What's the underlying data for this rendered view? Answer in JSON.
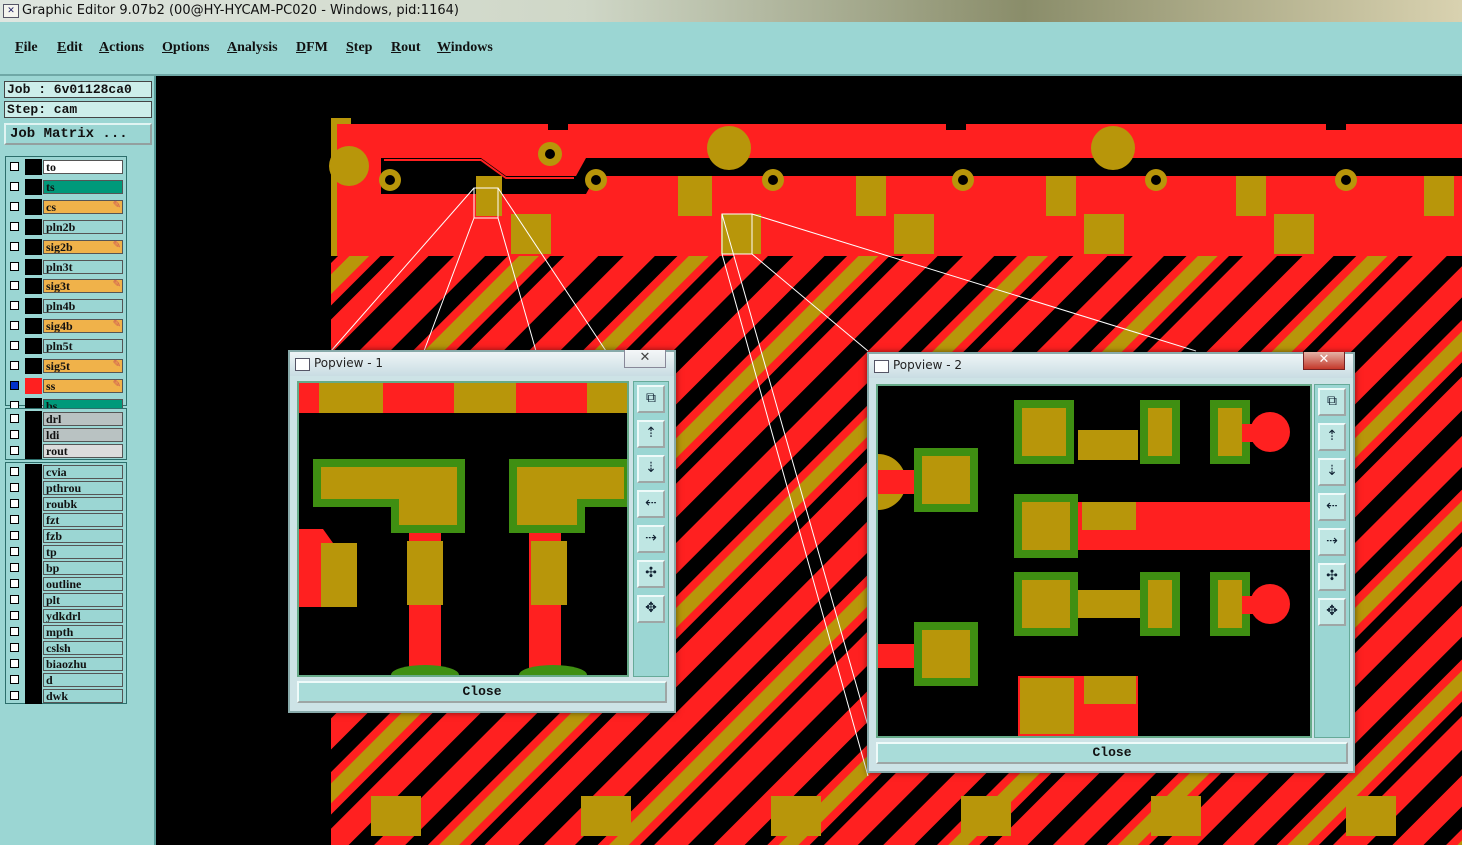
{
  "title_bar": {
    "title": "Graphic Editor 9.07b2 (00@HY-HYCAM-PC020 - Windows, pid:1164)",
    "icon": "app-x-icon"
  },
  "menu": [
    "File",
    "Edit",
    "Actions",
    "Options",
    "Analysis",
    "DFM",
    "Step",
    "Rout",
    "Windows"
  ],
  "info": {
    "job": "Job : 6v01128ca0",
    "step": "Step: cam",
    "job_matrix": "Job Matrix ..."
  },
  "layers_group1": [
    {
      "name": "to",
      "color": "#ffffff"
    },
    {
      "name": "ts",
      "color": "#00997a"
    },
    {
      "name": "cs",
      "color": "#f0b24a",
      "editable": true
    },
    {
      "name": "pln2b",
      "color": "#9bd6d3"
    },
    {
      "name": "sig2b",
      "color": "#f0b24a",
      "editable": true
    },
    {
      "name": "pln3t",
      "color": "#9bd6d3"
    },
    {
      "name": "sig3t",
      "color": "#f0b24a",
      "editable": true
    },
    {
      "name": "pln4b",
      "color": "#9bd6d3"
    },
    {
      "name": "sig4b",
      "color": "#f0b24a",
      "editable": true
    },
    {
      "name": "pln5t",
      "color": "#9bd6d3"
    },
    {
      "name": "sig5t",
      "color": "#f0b24a",
      "editable": true
    },
    {
      "name": "ss",
      "color": "#f0b24a",
      "editable": true,
      "active": true
    },
    {
      "name": "bs",
      "color": "#00997a"
    }
  ],
  "layers_group2": [
    {
      "name": "drl",
      "color": "#b9c2c2"
    },
    {
      "name": "ldi",
      "color": "#b9c2c2"
    },
    {
      "name": "rout",
      "color": "#dcdcdc"
    }
  ],
  "layers_group3": [
    {
      "name": "cvia"
    },
    {
      "name": "pthrou"
    },
    {
      "name": "roubk"
    },
    {
      "name": "fzt"
    },
    {
      "name": "fzb"
    },
    {
      "name": "tp"
    },
    {
      "name": "bp"
    },
    {
      "name": "outline"
    },
    {
      "name": "plt"
    },
    {
      "name": "ydkdrl"
    },
    {
      "name": "mpth"
    },
    {
      "name": "cslsh"
    },
    {
      "name": "biaozhu"
    },
    {
      "name": "d"
    },
    {
      "name": "dwk"
    }
  ],
  "popviews": [
    {
      "title": "Popview - 1",
      "close_label": "Close",
      "close_x": "✕"
    },
    {
      "title": "Popview - 2",
      "close_label": "Close",
      "close_x": "✕"
    }
  ],
  "tool_icons": [
    "zoom-fit-icon",
    "zoom-in-icon",
    "zoom-out-icon",
    "pan-left-icon",
    "pan-right-icon",
    "zoom-extents-icon",
    "zoom-home-icon"
  ],
  "colors": {
    "board_red": "#ff2020",
    "pad_gold": "#b8960a",
    "mask_green": "#3f8f12",
    "panel_teal": "#9bd6d3",
    "background": "#000000"
  }
}
